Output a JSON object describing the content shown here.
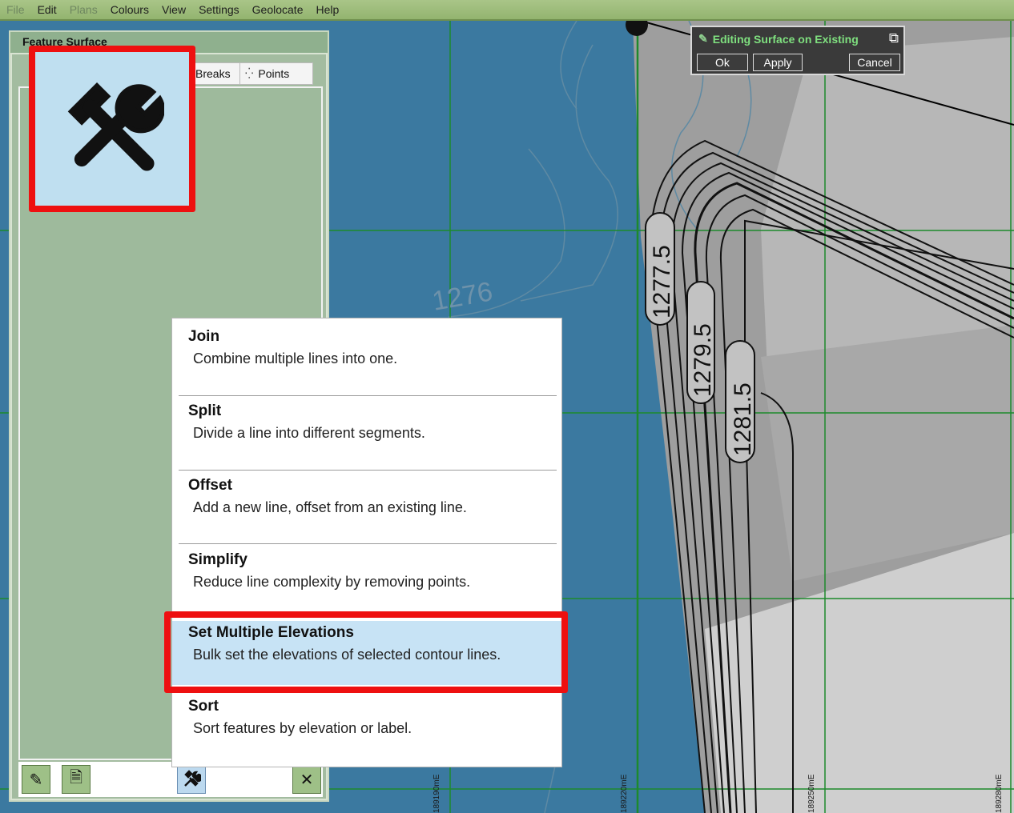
{
  "menubar": {
    "items": [
      "File",
      "Edit",
      "Plans",
      "Colours",
      "View",
      "Settings",
      "Geolocate",
      "Help"
    ]
  },
  "panel": {
    "title": "Feature Surface",
    "tabs": {
      "breaks": "Breaks",
      "points": "Points"
    }
  },
  "editing": {
    "title": "Editing Surface on Existing",
    "ok": "Ok",
    "apply": "Apply",
    "cancel": "Cancel"
  },
  "map": {
    "contour_label": "1276",
    "elevation_labels": [
      "1277.5",
      "1279.5",
      "1281.5"
    ],
    "easting_labels": [
      "189190mE",
      "189220mE",
      "189250mE",
      "189280mE"
    ]
  },
  "menu": {
    "items": [
      {
        "title": "Join",
        "desc": "Combine multiple lines into one."
      },
      {
        "title": "Split",
        "desc": "Divide a line into different segments."
      },
      {
        "title": "Offset",
        "desc": "Add a new line, offset from an existing line."
      },
      {
        "title": "Simplify",
        "desc": "Reduce line complexity by removing points."
      },
      {
        "title": "Set Multiple Elevations",
        "desc": "Bulk set the elevations of selected contour lines."
      },
      {
        "title": "Sort",
        "desc": "Sort features by elevation or label."
      }
    ],
    "selected_index": 4
  },
  "colors": {
    "highlight": "#ee1010",
    "selection": "#c7e3f5",
    "map_water": "#3b79a0",
    "grid": "#1d8a2c"
  }
}
